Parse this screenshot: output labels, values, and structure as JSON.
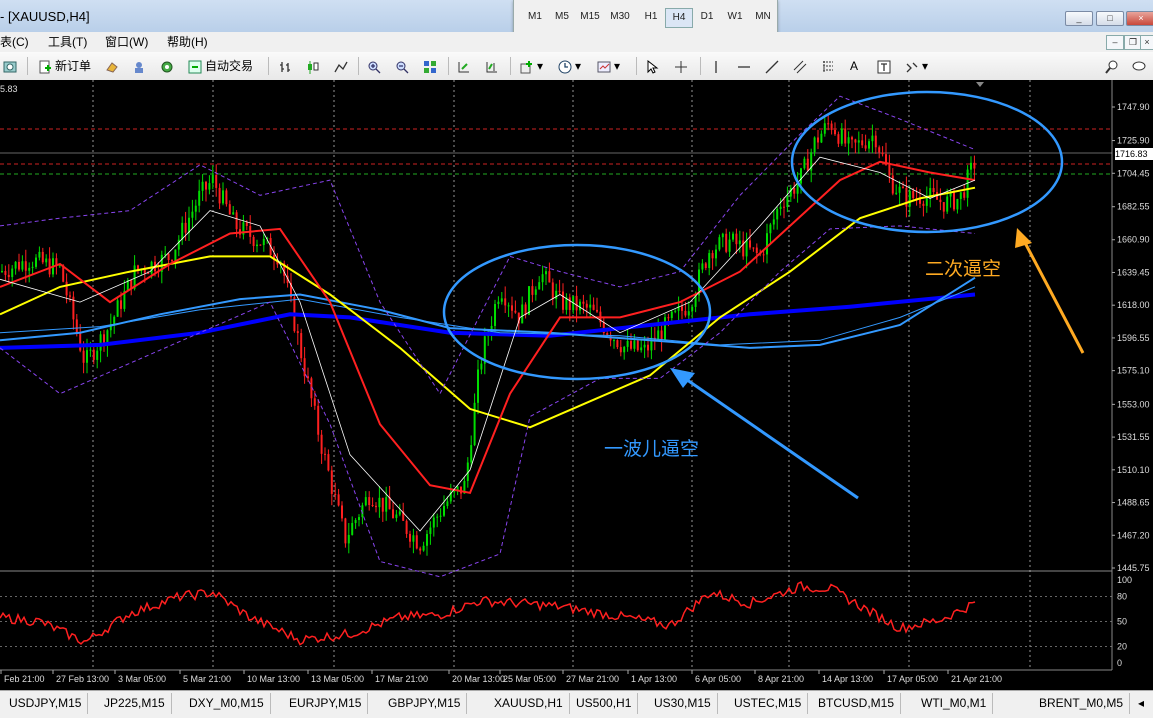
{
  "window": {
    "title": "- [XAUUSD,H4]",
    "controls": [
      "_",
      "□",
      "×"
    ]
  },
  "timeframes": [
    "M1",
    "M5",
    "M15",
    "M30",
    "H1",
    "H4",
    "D1",
    "W1",
    "MN"
  ],
  "active_timeframe": "H4",
  "menu": [
    "图表(C)",
    "工具(T)",
    "窗口(W)",
    "帮助(H)"
  ],
  "menu_visible": [
    "表(C)",
    "工具(T)",
    "窗口(W)",
    "帮助(H)"
  ],
  "toolbar": {
    "new_order": "新订单",
    "auto_trade": "自动交易",
    "text_tool": "A"
  },
  "chart": {
    "symbol": "XAUUSD",
    "timeframe": "H4",
    "top_left_price": "5.83",
    "current_price": "1716.83",
    "price_axis": [
      "1747.90",
      "1725.90",
      "1704.45",
      "1682.55",
      "1660.90",
      "1639.45",
      "1618.00",
      "1596.55",
      "1575.10",
      "1553.00",
      "1531.55",
      "1510.10",
      "1488.65",
      "1467.20",
      "1445.75"
    ],
    "time_axis": [
      "Feb 21:00",
      "27 Feb 13:00",
      "3 Mar 05:00",
      "5 Mar 21:00",
      "10 Mar 13:00",
      "13 Mar 05:00",
      "17 Mar 21:00",
      "20 Mar 13:00",
      "25 Mar 05:00",
      "27 Mar 21:00",
      "1 Apr 13:00",
      "6 Apr 05:00",
      "8 Apr 21:00",
      "14 Apr 13:00",
      "17 Apr 05:00",
      "21 Apr 21:00"
    ],
    "oscillator_axis": [
      "100",
      "80",
      "50",
      "20",
      "0"
    ],
    "annotations": {
      "first_wave": "一波儿逼空",
      "second_wave": "二次逼空"
    },
    "colors": {
      "bull": "#00dd00",
      "bear": "#ff2020",
      "ma_fast": "#ff2020",
      "ma_mid": "#ffff00",
      "ma_slow": "#0000ff",
      "ma_long": "#3399ff",
      "bands": "#8844ee",
      "annotation_blue": "#3399ff",
      "annotation_orange": "#ffaa22"
    }
  },
  "tabs": [
    "USDJPY,M15",
    "JP225,M15",
    "DXY_M0,M15",
    "EURJPY,M15",
    "GBPJPY,M15",
    "XAUUSD,H1",
    "US500,H1",
    "US30,M15",
    "USTEC,M15",
    "BTCUSD,M15",
    "WTI_M0,M1",
    "BRENT_M0,M5"
  ]
}
